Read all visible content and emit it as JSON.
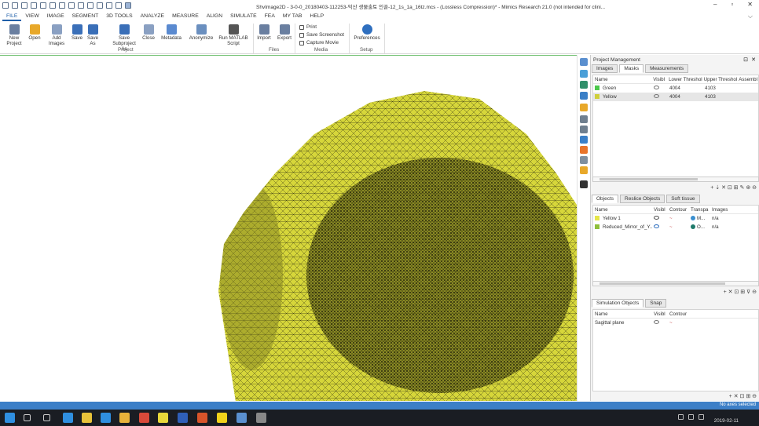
{
  "window": {
    "title": "ShvImage2D - 3-0-0_20180403-112253-익산 생물출토 인골-12_1s_1a_16tz.mcs - (Lossless Compression)* - Mimics Research 21.0 (not intended for clini...",
    "minimize": "–",
    "restore": "▫",
    "close": "✕"
  },
  "ribbon_tabs": [
    "FILE",
    "VIEW",
    "IMAGE",
    "SEGMENT",
    "3D TOOLS",
    "ANALYZE",
    "MEASURE",
    "ALIGN",
    "SIMULATE",
    "FEA",
    "MY TAB",
    "HELP"
  ],
  "ribbon_collapse": "⌵",
  "ribbon": {
    "project_buttons": [
      {
        "label": "New\nProject",
        "icon": "new-project-icon",
        "color": "#6a7fa0"
      },
      {
        "label": "Open",
        "icon": "open-folder-icon",
        "color": "#e8a82a"
      },
      {
        "label": "Add\nImages",
        "icon": "add-images-icon",
        "color": "#8aa0c2"
      },
      {
        "label": "Save",
        "icon": "save-icon",
        "color": "#3a6fb8"
      },
      {
        "label": "Save\nAs",
        "icon": "save-as-icon",
        "color": "#3a6fb8"
      },
      {
        "label": "Save Subproject\nAs",
        "icon": "save-subproject-icon",
        "color": "#3a6fb8"
      },
      {
        "label": "Close",
        "icon": "close-project-icon",
        "color": "#8aa0c2"
      },
      {
        "label": "Metadata",
        "icon": "metadata-icon",
        "color": "#5a8ad0"
      },
      {
        "label": "Anonymize",
        "icon": "anonymize-icon",
        "color": "#6a8fbf"
      },
      {
        "label": "Run MATLAB\nScript",
        "icon": "matlab-script-icon",
        "color": "#555555"
      }
    ],
    "project_group": "Project",
    "files_buttons": [
      {
        "label": "Import",
        "icon": "import-icon",
        "color": "#6a7fa0"
      },
      {
        "label": "Export",
        "icon": "export-icon",
        "color": "#6a7fa0"
      }
    ],
    "files_group": "Files",
    "media_buttons": [
      {
        "label": "Print",
        "icon": "print-icon"
      },
      {
        "label": "Save Screenshot",
        "icon": "screenshot-icon"
      },
      {
        "label": "Capture Movie",
        "icon": "movie-icon"
      }
    ],
    "media_group": "Media",
    "setup_button": {
      "label": "Preferences",
      "icon": "gear-icon",
      "color": "#2f6fbf"
    },
    "setup_group": "Setup"
  },
  "viewport": {
    "mesh_color": "#d8d83a",
    "mesh_line_color": "#2a2a10"
  },
  "panel": {
    "title": "Project Management",
    "pin": "⊡",
    "close": "✕",
    "mask_tabs": [
      "Images",
      "Masks",
      "Measurements"
    ],
    "mask_headers": [
      "Name",
      "Visibl",
      "Lower Threshol",
      "Upper Threshol",
      "Assembl"
    ],
    "masks": [
      {
        "name": "Green",
        "color": "#4cc84c",
        "lower": "4004",
        "upper": "4103"
      },
      {
        "name": "Yellow",
        "color": "#cfcf3a",
        "lower": "4004",
        "upper": "4103"
      }
    ],
    "mask_tools": "+ ⇣ ✕ ⊡ ⊞ ✎ ⊛ ⊖",
    "object_tabs": [
      "Objects",
      "Reslice Objects",
      "Soft tissue"
    ],
    "object_headers": [
      "Name",
      "Visibl",
      "Contour",
      "Transpa",
      "Images"
    ],
    "objects": [
      {
        "name": "Yellow 1",
        "color": "#e6e64a",
        "transp": "M...",
        "transp_color": "#3a8fd0",
        "images": "n/a"
      },
      {
        "name": "Reduced_Mirror_of_Y...",
        "color": "#8fbf3a",
        "transp": "O...",
        "transp_color": "#1f7a6a",
        "images": "n/a"
      }
    ],
    "object_tools": "+ ✕ ⊡ ⊞ ⊽ ⊖",
    "sim_tabs": [
      "Simulation Objects",
      "Snap"
    ],
    "sim_headers": [
      "Name",
      "Visibl",
      "Contour"
    ],
    "sim_objects": [
      {
        "name": "Sagittal plane"
      }
    ],
    "sim_tools": "+ ✕ ⊡ ⊞ ⊖"
  },
  "status": {
    "text": "No axes selected"
  },
  "taskbar": {
    "apps": [
      {
        "icon": "windows-start-icon",
        "color": "#2f8fe0"
      },
      {
        "icon": "search-icon",
        "color": "#cccccc"
      },
      {
        "icon": "task-view-icon",
        "color": "#cccccc"
      },
      {
        "icon": "edge-browser-icon",
        "color": "#2f8fe0"
      },
      {
        "icon": "file-explorer-icon",
        "color": "#e8c23a"
      },
      {
        "icon": "store-icon",
        "color": "#2f8fe0"
      },
      {
        "icon": "folder-icon",
        "color": "#e8b23a"
      },
      {
        "icon": "chrome-icon",
        "color": "#d84a3a"
      },
      {
        "icon": "sticky-notes-icon",
        "color": "#e8d83a"
      },
      {
        "icon": "word-icon",
        "color": "#2f5fb8"
      },
      {
        "icon": "powerpoint-icon",
        "color": "#d8542a"
      },
      {
        "icon": "kakaotalk-icon",
        "color": "#f2d21a"
      },
      {
        "icon": "mimics-icon",
        "color": "#5a8fcf"
      },
      {
        "icon": "app-icon",
        "color": "#888888"
      }
    ],
    "clock_date": "2019-02-11"
  }
}
